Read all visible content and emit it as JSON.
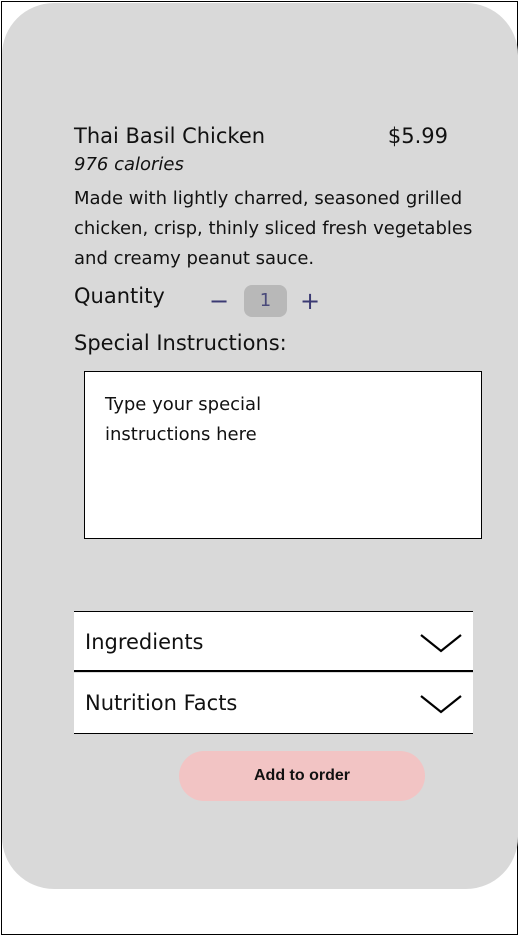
{
  "item": {
    "name": "Thai Basil Chicken",
    "price": "$5.99",
    "calories": "976 calories",
    "description": "Made with lightly charred, seasoned grilled chicken, crisp, thinly sliced fresh vegetables and creamy peanut sauce."
  },
  "quantity": {
    "label": "Quantity",
    "decrement": "−",
    "value": "1",
    "increment": "+"
  },
  "special_instructions": {
    "label": "Special Instructions:",
    "placeholder": "Type your special instructions here"
  },
  "accordions": [
    {
      "label": "Ingredients",
      "icon": "chevron-down-icon"
    },
    {
      "label": "Nutrition Facts",
      "icon": "chevron-down-icon"
    }
  ],
  "actions": {
    "add_to_order": "Add to order"
  },
  "colors": {
    "card_background": "#d9d9d9",
    "button_background": "#f2c4c4",
    "stepper_accent": "#3b3a73",
    "stepper_value_background": "#b8b8b8"
  }
}
